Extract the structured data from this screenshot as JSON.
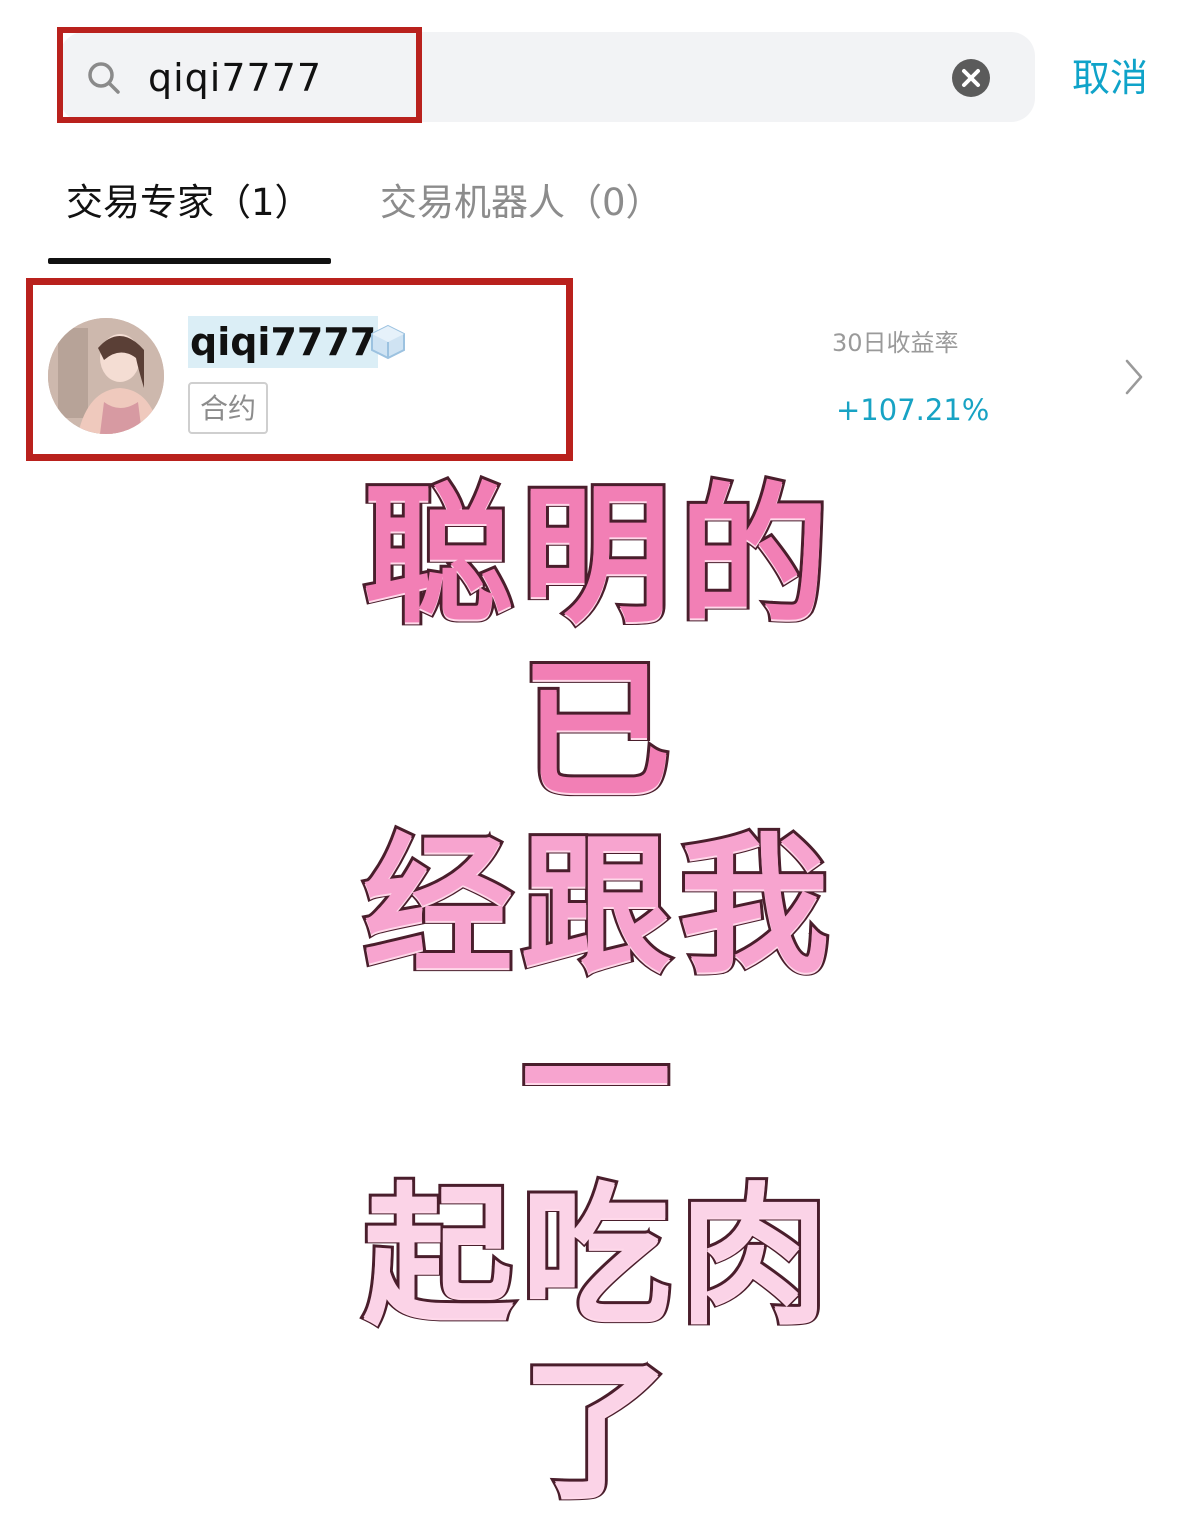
{
  "search": {
    "query": "qiqi7777",
    "cancel_label": "取消"
  },
  "tabs": [
    {
      "label": "交易专家（1）",
      "active": true
    },
    {
      "label": "交易机器人（0）",
      "active": false
    }
  ],
  "results": [
    {
      "username": "qiqi7777",
      "tag": "合约",
      "metric_label": "30日收益率",
      "metric_value": "+107.21%"
    }
  ],
  "caption": {
    "lines": [
      "聪明的已",
      "经跟我一",
      "起吃肉了"
    ]
  },
  "colors": {
    "accent": "#0fa3c9",
    "gain": "#18a3c4",
    "highlight_box": "#b9211d",
    "caption_fill": "#f27fb5",
    "caption_stroke": "#4a1e2c"
  }
}
